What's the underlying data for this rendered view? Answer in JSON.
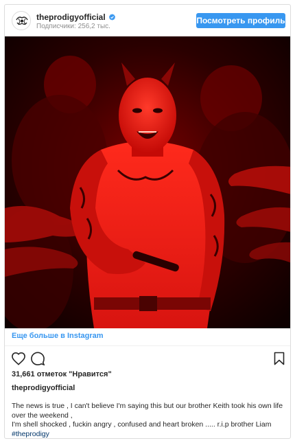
{
  "header": {
    "account_name": "theprodigyofficial",
    "followers_text": "Подписчики: 256,2 тыс.",
    "view_profile_label": "Посмотреть профиль",
    "avatar_icon": "prodigy-logo-icon",
    "verified_icon": "verified-badge-icon"
  },
  "post": {
    "image_description_icon": "post-photo",
    "more_link": "Еще больше в Instagram",
    "likes": "31,661 отметок \"Нравится\"",
    "author": "theprodigyofficial",
    "caption_line1": "The news is true , I can't believe I'm saying this but our brother Keith took his own life over the weekend ,",
    "caption_line2": "I'm shell shocked , fuckin angry , confused and heart broken ..... r.i.p brother Liam",
    "hashtag": "#theprodigy"
  },
  "actions": {
    "like_icon": "heart-icon",
    "comment_icon": "comment-icon",
    "save_icon": "bookmark-icon"
  },
  "colors": {
    "accent": "#3897f0",
    "text": "#262626",
    "muted": "#8e8e8e",
    "hashtag": "#003569",
    "photo_red": "#e0120f"
  }
}
